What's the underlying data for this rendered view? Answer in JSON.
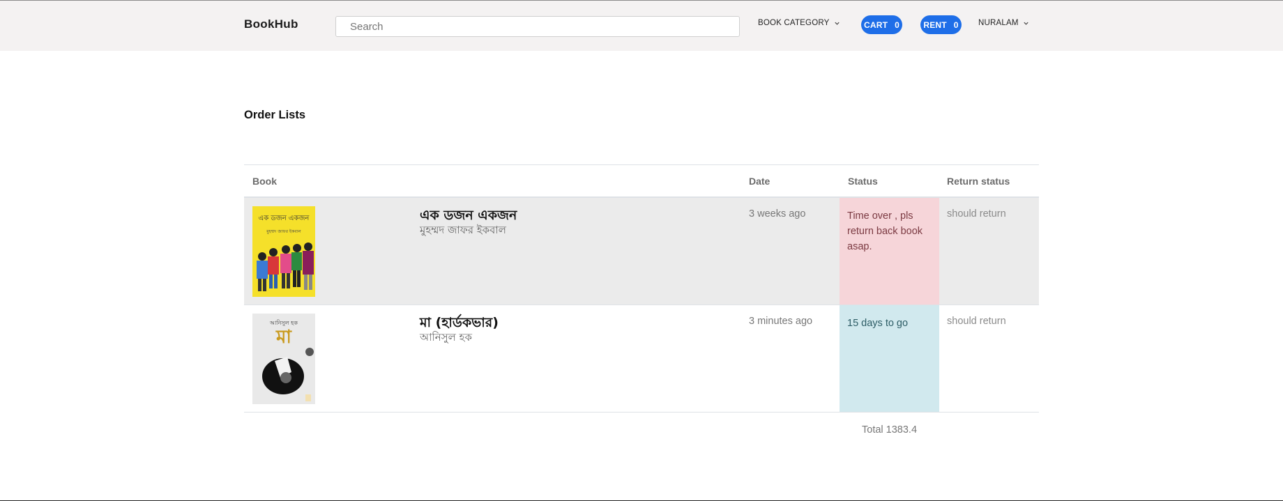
{
  "navbar": {
    "brand": "BookHub",
    "search_placeholder": "Search",
    "category_label": "BOOK CATEGORY",
    "cart_label": "CART",
    "cart_count": "0",
    "rent_label": "RENT",
    "rent_count": "0",
    "user_label": "NURALAM",
    "accent_color": "#1e6ee8"
  },
  "page": {
    "title": "Order Lists"
  },
  "table": {
    "headers": {
      "book": "Book",
      "date": "Date",
      "status": "Status",
      "return_status": "Return status"
    },
    "rows": [
      {
        "title": "এক ডজন একজন",
        "author": "মুহম্মদ জাফর ইকবাল",
        "cover_title": "এক ডজন একজন",
        "cover_author": "মুহম্মদ জাফর ইকবাল",
        "date": "3 weeks ago",
        "status": "Time over , pls return back book asap.",
        "return_status": "should return"
      },
      {
        "title": "মা (হার্ডকভার)",
        "author": "আনিসুল হক",
        "cover_title": "মা",
        "cover_author": "আনিসুল হক",
        "date": "3 minutes ago",
        "status": "15 days to go",
        "return_status": "should return"
      }
    ],
    "total": "Total 1383.4"
  }
}
